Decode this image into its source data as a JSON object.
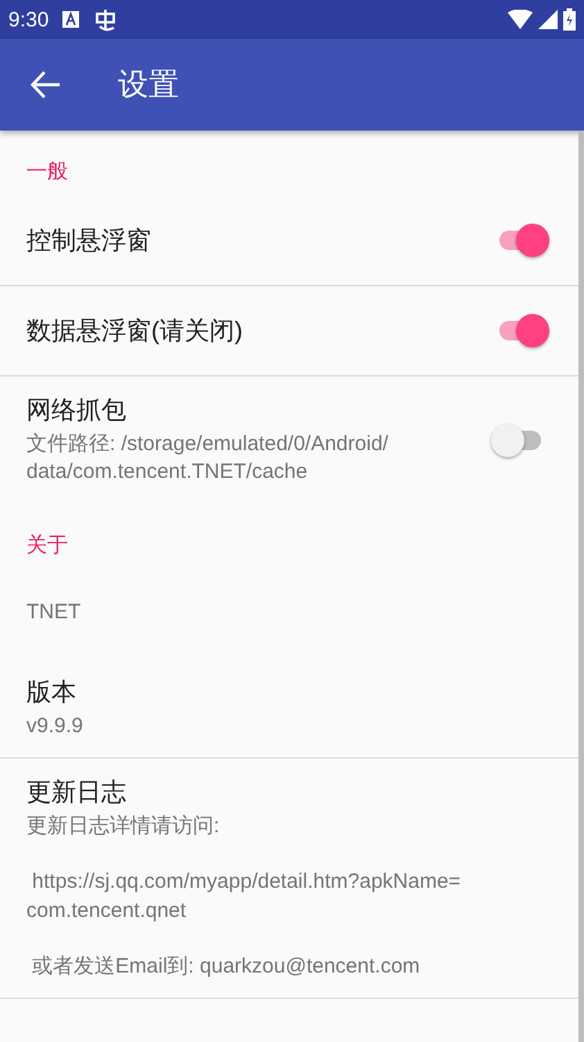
{
  "status_bar": {
    "time": "9:30"
  },
  "app_bar": {
    "title": "设置"
  },
  "sections": [
    {
      "header": "一般",
      "items": [
        {
          "kind": "switch",
          "title": "控制悬浮窗",
          "on": true,
          "divider": true
        },
        {
          "kind": "switch",
          "title": "数据悬浮窗(请关闭)",
          "on": true,
          "divider": true
        },
        {
          "kind": "switch",
          "title": "网络抓包",
          "summary": "文件路径: /storage/emulated/0/Android/\ndata/com.tencent.TNET/cache",
          "on": false,
          "divider": false
        }
      ]
    },
    {
      "header": "关于",
      "items": [
        {
          "kind": "text",
          "summary": "TNET",
          "divider": false
        },
        {
          "kind": "text",
          "title": "版本",
          "summary": "v9.9.9",
          "divider": true
        },
        {
          "kind": "text",
          "title": "更新日志",
          "summary": "更新日志详情请访问:\n\n https://sj.qq.com/myapp/detail.htm?apkName=\ncom.tencent.qnet\n\n 或者发送Email到: quarkzou@tencent.com",
          "divider": true
        }
      ]
    }
  ]
}
